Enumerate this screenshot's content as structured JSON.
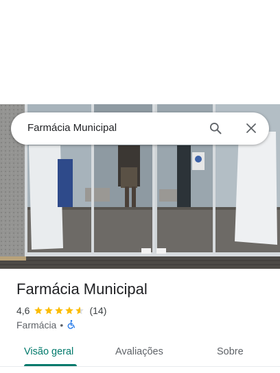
{
  "search": {
    "query": "Farmácia Municipal",
    "search_icon": "search-icon",
    "close_icon": "close-icon"
  },
  "hero": {
    "image": "storefront-photo"
  },
  "place": {
    "name": "Farmácia Municipal",
    "rating": "4,6",
    "stars": 4.6,
    "review_count": "(14)",
    "category": "Farmácia",
    "separator": "•",
    "accessibility_icon": "wheelchair-icon"
  },
  "tabs": [
    {
      "label": "Visão geral",
      "active": true
    },
    {
      "label": "Avaliações",
      "active": false
    },
    {
      "label": "Sobre",
      "active": false
    }
  ],
  "colors": {
    "accent": "#00796b",
    "star": "#fbbc04",
    "accessibility": "#1a73e8"
  }
}
